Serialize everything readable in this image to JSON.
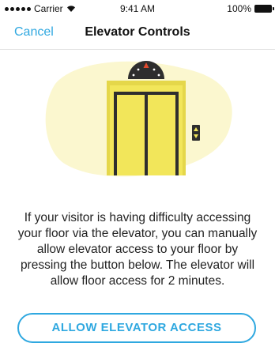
{
  "status_bar": {
    "carrier": "Carrier",
    "time": "9:41 AM",
    "battery": "100%"
  },
  "nav": {
    "cancel_label": "Cancel",
    "title": "Elevator Controls"
  },
  "illustration": {
    "icon": "elevator-illustration",
    "blob_color": "#FBF7CF",
    "door_color": "#F2E65A",
    "frame_color": "#2E2E2E",
    "indicator_arrow_color": "#E04A2F"
  },
  "description": "If your visitor is having difficulty accessing your floor via the elevator, you can manually allow elevator access to your  floor  by pressing the button below. The elevator will allow floor access for 2 minutes.",
  "action": {
    "allow_label": "ALLOW ELEVATOR ACCESS",
    "accent_color": "#2FA8E0"
  }
}
